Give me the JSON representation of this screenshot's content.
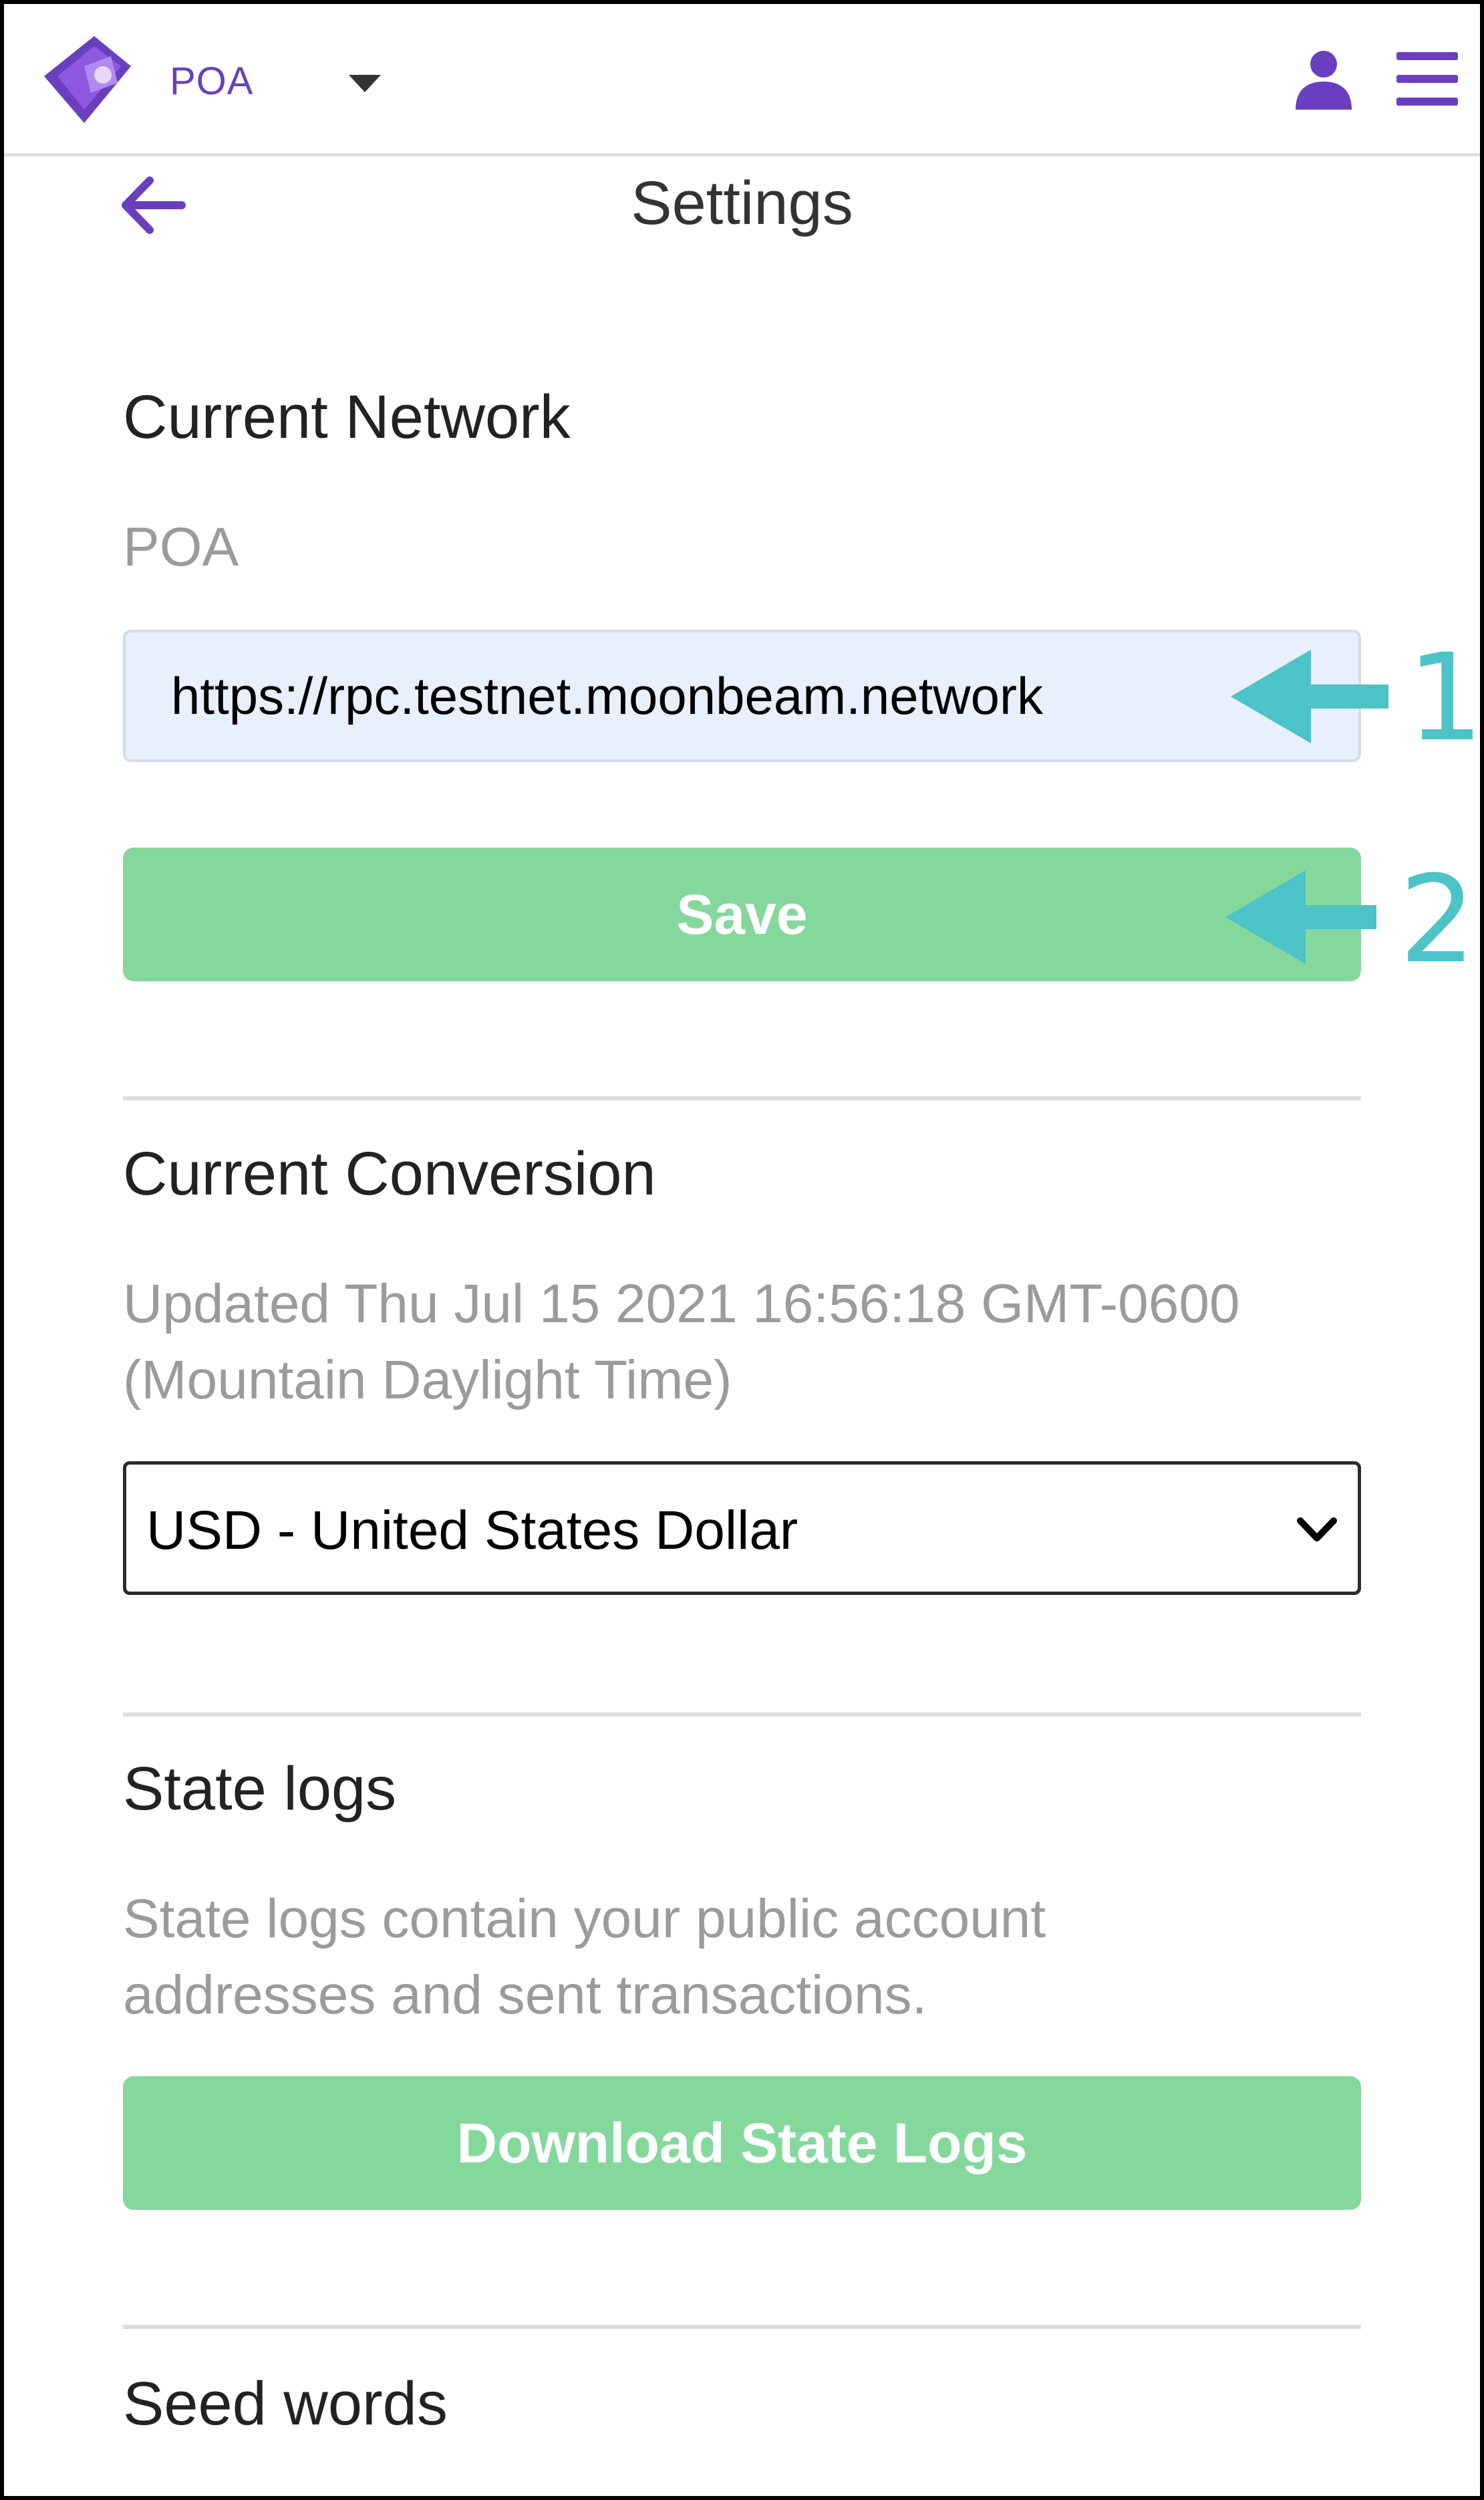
{
  "header": {
    "network_name": "POA",
    "icons": [
      "metamask-logo",
      "caret-down-icon",
      "account-icon",
      "menu-icon"
    ]
  },
  "page": {
    "title": "Settings",
    "back_icon": "back-arrow-icon"
  },
  "current_network": {
    "heading": "Current Network",
    "network_name": "POA",
    "rpc_url": "https://rpc.testnet.moonbeam.network",
    "save_label": "Save"
  },
  "current_conversion": {
    "heading": "Current Conversion",
    "updated_line1": "Updated Thu Jul 15 2021 16:56:18 GMT-0600",
    "updated_line2": "(Mountain Daylight Time)",
    "selected_currency": "USD - United States Dollar"
  },
  "state_logs": {
    "heading": "State logs",
    "description_line1": "State logs contain your public account",
    "description_line2": "addresses and sent transactions.",
    "download_label": "Download State Logs"
  },
  "seed_words": {
    "heading": "Seed words"
  },
  "annotations": [
    {
      "number": "1"
    },
    {
      "number": "2"
    }
  ],
  "colors": {
    "accent_purple": "#6a3fbf",
    "button_green": "#85d89c",
    "annotation_teal": "#4cc3c6",
    "input_bg": "#e8effd"
  }
}
